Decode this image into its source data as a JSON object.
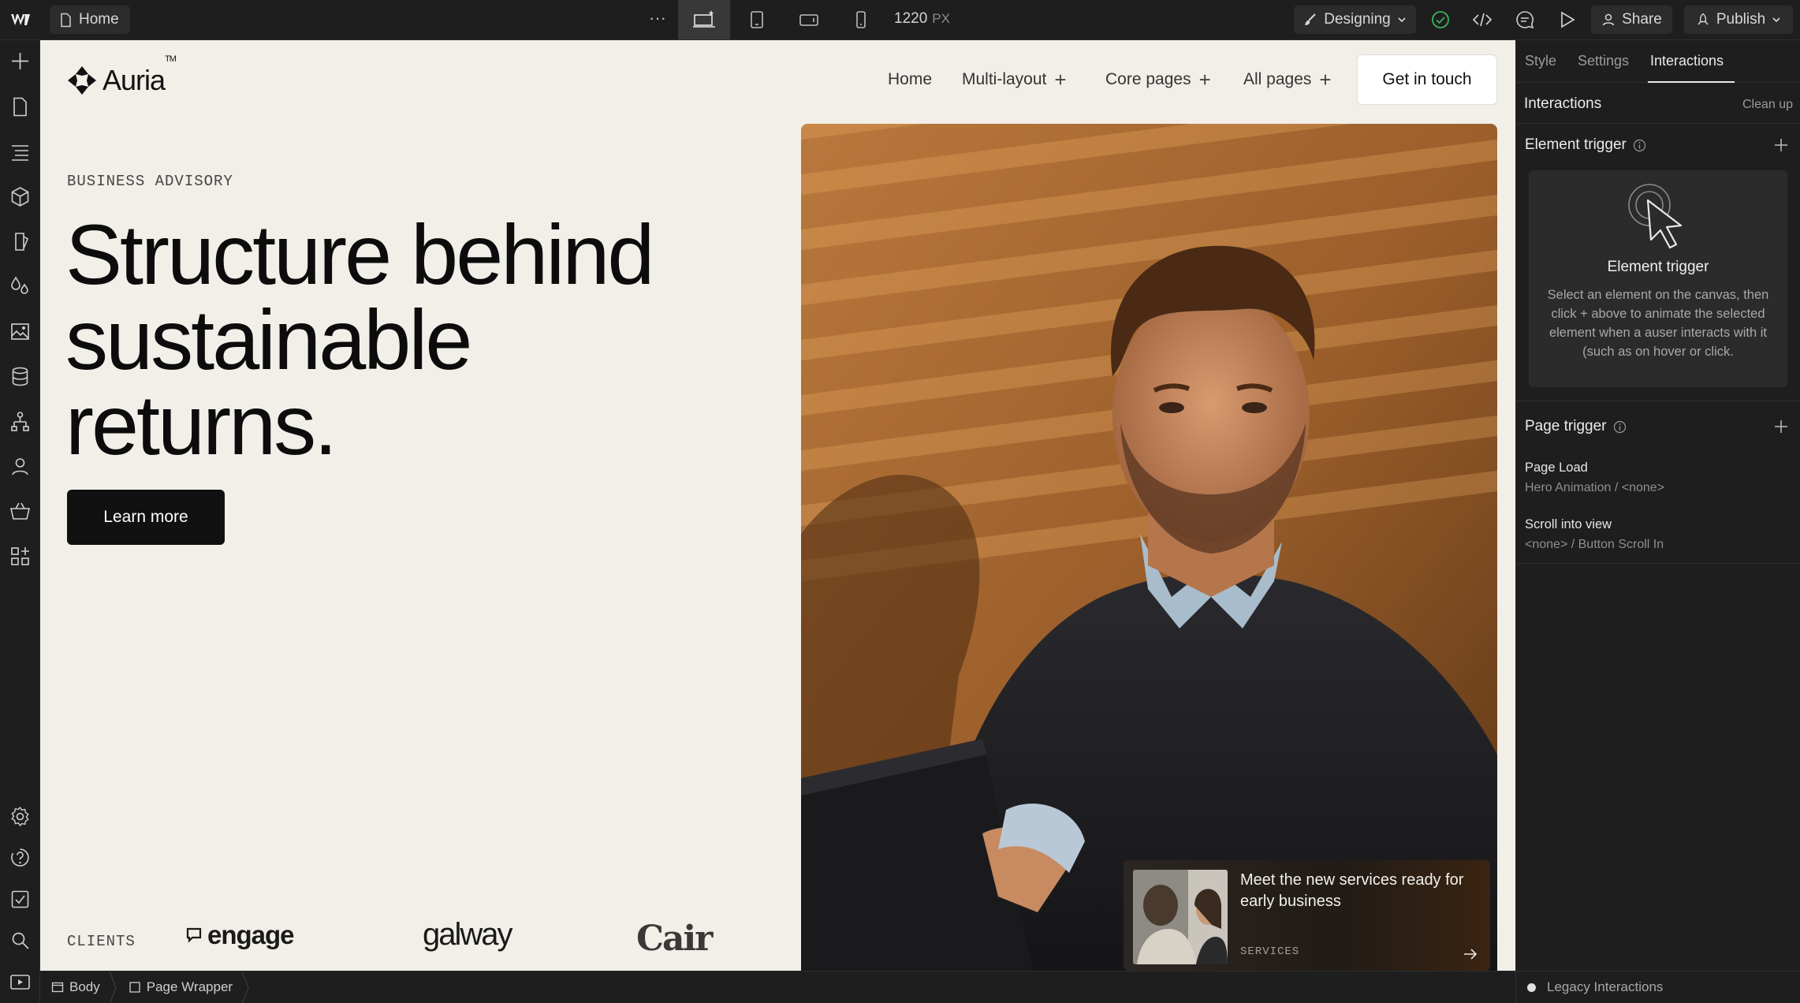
{
  "topbar": {
    "page_name": "Home",
    "more": "···",
    "canvas_width": "1220",
    "canvas_unit": "PX",
    "mode": "Designing",
    "share": "Share",
    "publish": "Publish"
  },
  "site": {
    "brand": "Auria",
    "brand_tm": "TM",
    "nav": [
      {
        "label": "Home",
        "has_plus": false
      },
      {
        "label": "Multi-layout",
        "has_plus": true
      },
      {
        "label": "Core pages",
        "has_plus": true
      },
      {
        "label": "All pages",
        "has_plus": true
      }
    ],
    "plus": "+",
    "cta": "Get in touch",
    "eyebrow": "BUSINESS ADVISORY",
    "headline_lines": [
      "Structure behind",
      "sustainable",
      "returns."
    ],
    "learn_more": "Learn more",
    "clients_label": "CLIENTS",
    "clients": [
      "engage",
      "galway",
      "Cair"
    ],
    "promo": {
      "title": "Meet the new services ready for early business",
      "tag": "SERVICES"
    }
  },
  "breadcrumb": [
    "Body",
    "Page Wrapper"
  ],
  "panel": {
    "tabs": [
      "Style",
      "Settings",
      "Interactions"
    ],
    "active_tab": "Interactions",
    "section_title": "Interactions",
    "cleanup": "Clean up",
    "element_trigger": {
      "title": "Element trigger",
      "card_title": "Element trigger",
      "card_desc": "Select an element on the canvas, then click + above to animate the selected element when a auser interacts with it (such as on hover or click."
    },
    "page_trigger": {
      "title": "Page trigger",
      "items": [
        {
          "title": "Page Load",
          "sub": "Hero Animation / <none>"
        },
        {
          "title": "Scroll into view",
          "sub": "<none> / Button Scroll In"
        }
      ]
    },
    "legacy": "Legacy Interactions"
  },
  "colors": {
    "canvas_bg": "#f2efe9",
    "editor_bg": "#1e1e1e",
    "check_green": "#3bb25c"
  },
  "icons": {
    "leftbar": [
      "add-icon",
      "pages-icon",
      "navigator-icon",
      "components-icon",
      "variables-icon",
      "styles-icon",
      "assets-icon",
      "cms-icon",
      "logic-icon",
      "users-icon",
      "ecommerce-icon",
      "apps-icon",
      "settings-icon",
      "help-icon",
      "audit-icon",
      "search-icon",
      "video-icon"
    ]
  }
}
